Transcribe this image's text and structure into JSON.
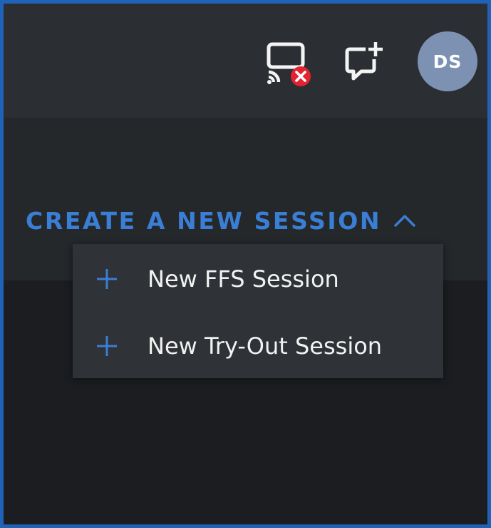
{
  "header": {
    "avatar_initials": "DS",
    "icons": {
      "cast": "cast-disconnected-icon",
      "chat": "chat-add-icon"
    }
  },
  "session": {
    "toggle_label": "CREATE A NEW SESSION",
    "expanded": true,
    "menu": {
      "items": [
        {
          "label": "New FFS Session",
          "icon": "plus-icon"
        },
        {
          "label": "New Try-Out Session",
          "icon": "plus-icon"
        }
      ]
    }
  },
  "colors": {
    "frame_border": "#1e63b8",
    "topbar": "#2b2e32",
    "subbar": "#25282b",
    "page": "#1b1d20",
    "accent": "#3a7fd5",
    "menu": "#2f3236",
    "avatar": "#7d92b3",
    "error_badge": "#e5232f"
  }
}
